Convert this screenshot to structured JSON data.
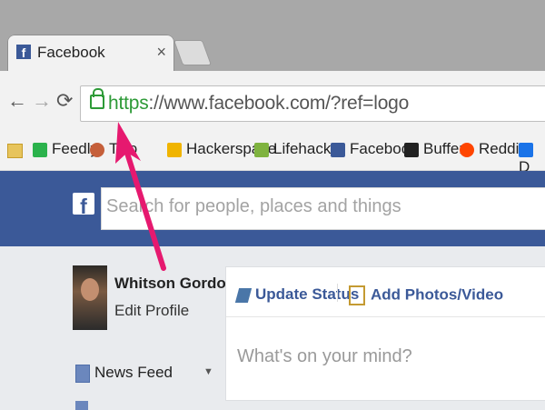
{
  "browser": {
    "tab_title": "Facebook",
    "tab_close": "×",
    "address": {
      "scheme": "https",
      "rest": "://www.facebook.com/?ref=logo"
    }
  },
  "bookmarks": [
    {
      "label": "Feedly",
      "icon": "feedly-icon",
      "color": "#2bb24c"
    },
    {
      "label": "Two",
      "icon": "two-icon",
      "color": "#c55f3a"
    },
    {
      "label": "Hackerspace",
      "icon": "hackerspace-icon",
      "color": "#f0b400"
    },
    {
      "label": "Lifehacker",
      "icon": "lifehacker-icon",
      "color": "#7fb33f"
    },
    {
      "label": "Facebook",
      "icon": "facebook-icon",
      "color": "#3b5998"
    },
    {
      "label": "Buffer",
      "icon": "buffer-icon",
      "color": "#222222"
    },
    {
      "label": "Reddit",
      "icon": "reddit-icon",
      "color": "#ff4500"
    },
    {
      "label": "D",
      "icon": "drive-icon",
      "color": "#1a73e8"
    }
  ],
  "facebook": {
    "search_placeholder": "Search for people, places and things",
    "profile_name": "Whitson Gordon",
    "edit_profile": "Edit Profile",
    "news_feed": "News Feed",
    "composer": {
      "update_status": "Update Status",
      "add_photos": "Add Photos/Video",
      "prompt": "What's on your mind?"
    }
  },
  "colors": {
    "facebook_blue": "#3b5998",
    "https_green": "#2d9a37",
    "arrow_pink": "#e6196f"
  }
}
